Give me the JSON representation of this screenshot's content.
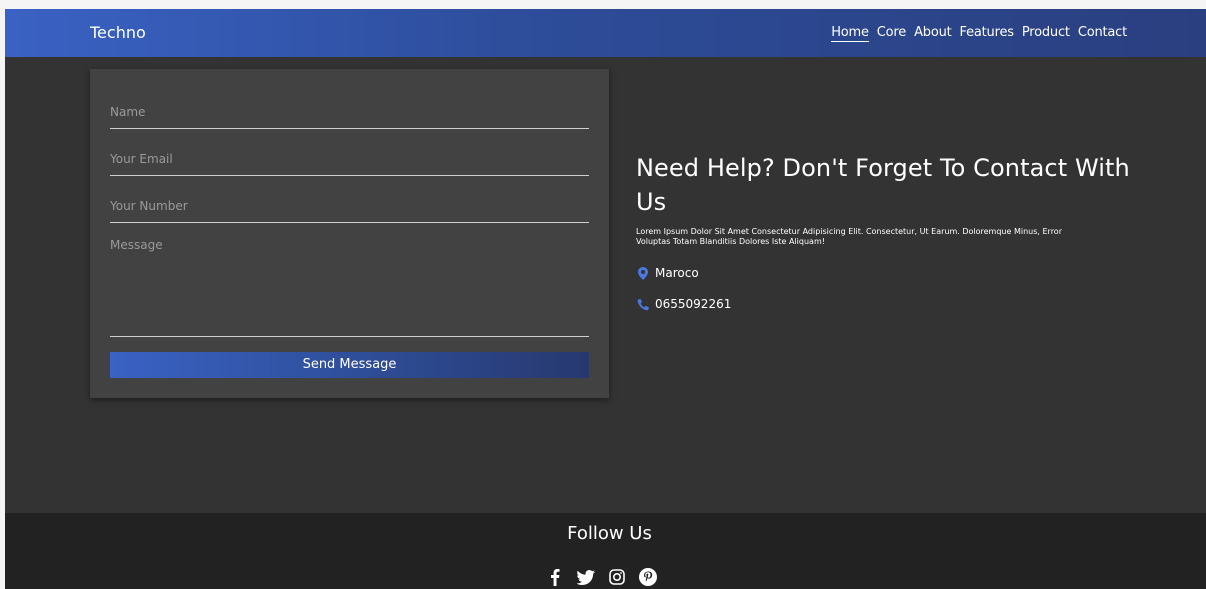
{
  "navbar": {
    "brand": "Techno",
    "links": [
      "Home",
      "Core",
      "About",
      "Features",
      "Product",
      "Contact"
    ],
    "active": "Home"
  },
  "form": {
    "name_placeholder": "Name",
    "email_placeholder": "Your Email",
    "number_placeholder": "Your Number",
    "message_placeholder": "Message",
    "send_label": "Send Message"
  },
  "contact": {
    "headline": "Need Help? Don't Forget To Contact With Us",
    "description": "Lorem Ipsum Dolor Sit Amet Consectetur Adipisicing Elit. Consectetur, Ut Earum. Doloremque Minus, Error Voluptas Totam Blanditiis Dolores Iste Aliquam!",
    "location": "Maroco",
    "phone": "0655092261",
    "icons": {
      "location": "map-marker-icon",
      "phone": "phone-icon"
    },
    "accent": "#3a62c4"
  },
  "footer": {
    "title": "Follow Us",
    "socials": [
      "facebook-icon",
      "twitter-icon",
      "instagram-icon",
      "pinterest-icon"
    ]
  },
  "colors": {
    "nav_gradient_start": "#3a62c4",
    "nav_gradient_end": "#2a3f7f",
    "page_bg": "#333333",
    "card_bg": "#424242",
    "footer_bg": "#222222"
  }
}
